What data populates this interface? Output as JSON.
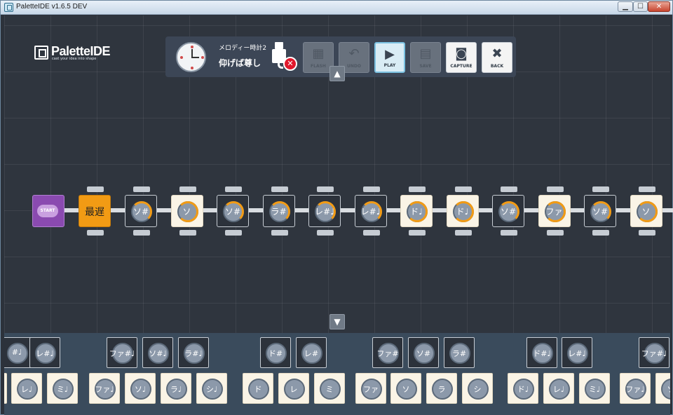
{
  "window": {
    "title": "PaletteIDE v1.6.5 DEV",
    "min_glyph": "▁",
    "max_glyph": "☐",
    "close_glyph": "✕"
  },
  "logo": {
    "name": "PaletteIDE",
    "tagline": "cast your idea into shape"
  },
  "project": {
    "subtitle": "メロディー時計2",
    "title": "仰げば尊し",
    "usb_status": "disconnected",
    "usb_error_glyph": "✕"
  },
  "toolbar": [
    {
      "label": "FLASH",
      "icon": "chip-icon",
      "glyph": "▦",
      "state": "disabled"
    },
    {
      "label": "UNDO",
      "icon": "undo-icon",
      "glyph": "↶",
      "state": "disabled"
    },
    {
      "label": "PLAY",
      "icon": "play-icon",
      "glyph": "▶",
      "state": "active"
    },
    {
      "label": "SAVE",
      "icon": "save-icon",
      "glyph": "▤",
      "state": "disabled"
    },
    {
      "label": "CAPTURE",
      "icon": "camera-icon",
      "glyph": "◙",
      "state": "enabled"
    },
    {
      "label": "BACK",
      "icon": "close-circle-icon",
      "glyph": "✖",
      "state": "enabled"
    }
  ],
  "scroll": {
    "up_glyph": "▲",
    "down_glyph": "▼"
  },
  "sequence": {
    "start_label": "START",
    "tempo_label": "最遅",
    "notes": [
      {
        "label": "ソ#",
        "style": "dark"
      },
      {
        "label": "ソ",
        "style": "light"
      },
      {
        "label": "ソ#",
        "style": "dark"
      },
      {
        "label": "ラ#",
        "style": "dark"
      },
      {
        "label": "レ#♩",
        "style": "dark"
      },
      {
        "label": "レ#♩",
        "style": "dark"
      },
      {
        "label": "ド♩",
        "style": "light"
      },
      {
        "label": "ド♩",
        "style": "light"
      },
      {
        "label": "ソ#",
        "style": "dark"
      },
      {
        "label": "ファ",
        "style": "light"
      },
      {
        "label": "ソ#",
        "style": "dark"
      },
      {
        "label": "ソ",
        "style": "light"
      }
    ]
  },
  "palette": {
    "top_row": [
      "#♩",
      "レ#♩",
      "ファ#♩",
      "ソ#♩",
      "ラ#♩",
      "ド#",
      "レ#",
      "ファ#",
      "ソ#",
      "ラ#",
      "ド#♩",
      "レ#♩",
      "ファ#♩"
    ],
    "bottom_row": [
      "",
      "レ♩",
      "ミ♩",
      "ファ♩",
      "ソ♩",
      "ラ♩",
      "シ♩",
      "ド",
      "レ",
      "ミ",
      "ファ",
      "ソ",
      "ラ",
      "シ",
      "ド♩",
      "レ♩",
      "ミ♩",
      "ファ♩",
      "ソ"
    ]
  },
  "colors": {
    "accent": "#f29b14",
    "start": "#8a4ab0",
    "canvas": "#2f353e",
    "palette_bg": "#3a4b5c"
  }
}
